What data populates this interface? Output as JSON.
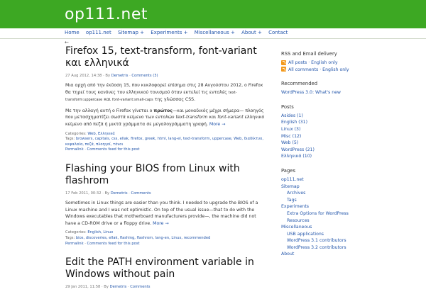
{
  "site": {
    "title": "op111.net"
  },
  "nav": {
    "items": [
      "Home",
      "op111.net",
      "Sitemap +",
      "Experiments +",
      "Miscellaneous +",
      "About +",
      "Contact"
    ],
    "back": "←"
  },
  "posts": [
    {
      "title": "Firefox 15, text-transform, font-variant και ελληνικά",
      "meta_date": "27 Aug 2012, 14:38",
      "meta_by": " · By ",
      "meta_author": "Demetris",
      "meta_sep": " · ",
      "meta_comments": "Comments (3)",
      "p1a": "Μια αρχή από την έκδοση 15, που κυκλοφορεί επίσημα στις 28 Αυγούστου 2012, ο Firefox θα τηρεί τους κανόνες του ελληνικού τονισμού όταν εκτελεί τις εντολές ",
      "p1b": "text-transform:uppercase",
      "p1c": " και ",
      "p1d": "font-variant:small-caps",
      "p1e": " της γλώσσας CSS.",
      "p2a": "Με την αλλαγή αυτή ο Firefox γίνεται ο ",
      "p2b": "πρώτος",
      "p2c": "—και μοναδικός μέχρι σήμερα— πλοηγός που μετασχηματίζει σωστά κείμενο των εντολών ",
      "p2d": "text-transform",
      "p2e": " και ",
      "p2f": "font-variant",
      "p2g": " ελληνικό κείμενο από πεζά ή μικτά γράμματα σε μεγαλογράμματη γραφή. ",
      "more": "More →",
      "categories_label": "Categories: ",
      "categories": "Web, Ελληνικά",
      "tags_label": "Tags: ",
      "tags": "browsers, capitals, css, ellak, firefox, greek, html, lang-el, text-transform, uppercase, Web, διαδίκτυο, κεφαλαία, πεζά, πλοηγοί, τόνοι",
      "permalink": "Permalink",
      "comments_feed": "Comments feed for this post"
    },
    {
      "title": "Flashing your BIOS from Linux with flashrom",
      "meta_date": "17 Feb 2011, 00:32",
      "meta_by": " · By ",
      "meta_author": "Demetris",
      "meta_sep": " · ",
      "meta_comments": "Comments",
      "body": "Sometimes in Linux things are easier than you think. I needed to upgrade the BIOS of a Linux machine and I was not optimistic. On top of the usual issue—that to do with the Windows executables that motherboard manufacturers provide—, the machine did not have a CD-ROM drive or a floppy drive. ",
      "more": "More →",
      "categories_label": "Categories: ",
      "categories": "English, Linux",
      "tags_label": "Tags: ",
      "tags": "bios, discoveries, ellak, flashing, flashrom, lang-en, Linux, recommended",
      "permalink": "Permalink",
      "comments_feed": "Comments feed for this post"
    },
    {
      "title": "Edit the PATH environment variable in Windows without pain",
      "meta_date": "29 Jan 2011, 11:58",
      "meta_by": " · By ",
      "meta_author": "Demetris",
      "meta_sep": " · ",
      "meta_comments": "Comments"
    }
  ],
  "sidebar": {
    "rss_heading": "RSS and Email delivery",
    "rss_rows": [
      "All posts · English only",
      "All comments · English only"
    ],
    "recommended_heading": "Recommended",
    "recommended": [
      "WordPress 3.0: What's new"
    ],
    "posts_heading": "Posts",
    "post_cats": [
      "Asides (1)",
      "English (31)",
      "Linux (3)",
      "Misc (12)",
      "Web (5)",
      "WordPress (21)",
      "Ελληνικά (10)"
    ],
    "pages_heading": "Pages",
    "pages": [
      "op111.net",
      "Sitemap",
      "Archives",
      "Tags",
      "Experiments",
      "Extra Options for WordPress",
      "Resources",
      "Miscellaneous",
      "USB applications",
      "WordPress 3.1 contributors",
      "WordPress 3.2 contributors",
      "About"
    ]
  },
  "colors": {
    "header": "#3da823",
    "link": "#2255aa",
    "rss": "#f39a1e"
  }
}
